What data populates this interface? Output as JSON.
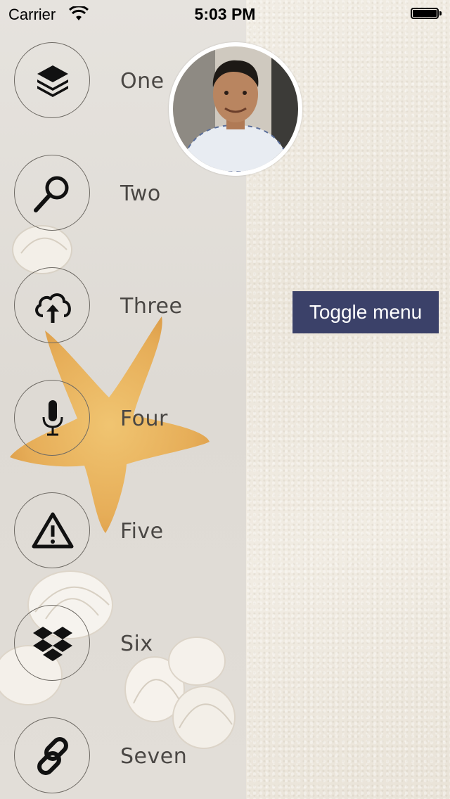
{
  "status_bar": {
    "carrier": "Carrier",
    "time": "5:03 PM"
  },
  "menu": {
    "items": [
      {
        "label": "One",
        "icon": "layers-icon"
      },
      {
        "label": "Two",
        "icon": "search-icon"
      },
      {
        "label": "Three",
        "icon": "cloud-upload-icon"
      },
      {
        "label": "Four",
        "icon": "microphone-icon"
      },
      {
        "label": "Five",
        "icon": "warning-icon"
      },
      {
        "label": "Six",
        "icon": "dropbox-icon"
      },
      {
        "label": "Seven",
        "icon": "link-icon"
      }
    ]
  },
  "main": {
    "toggle_label": "Toggle menu",
    "toggle_color": "#3b4169"
  }
}
